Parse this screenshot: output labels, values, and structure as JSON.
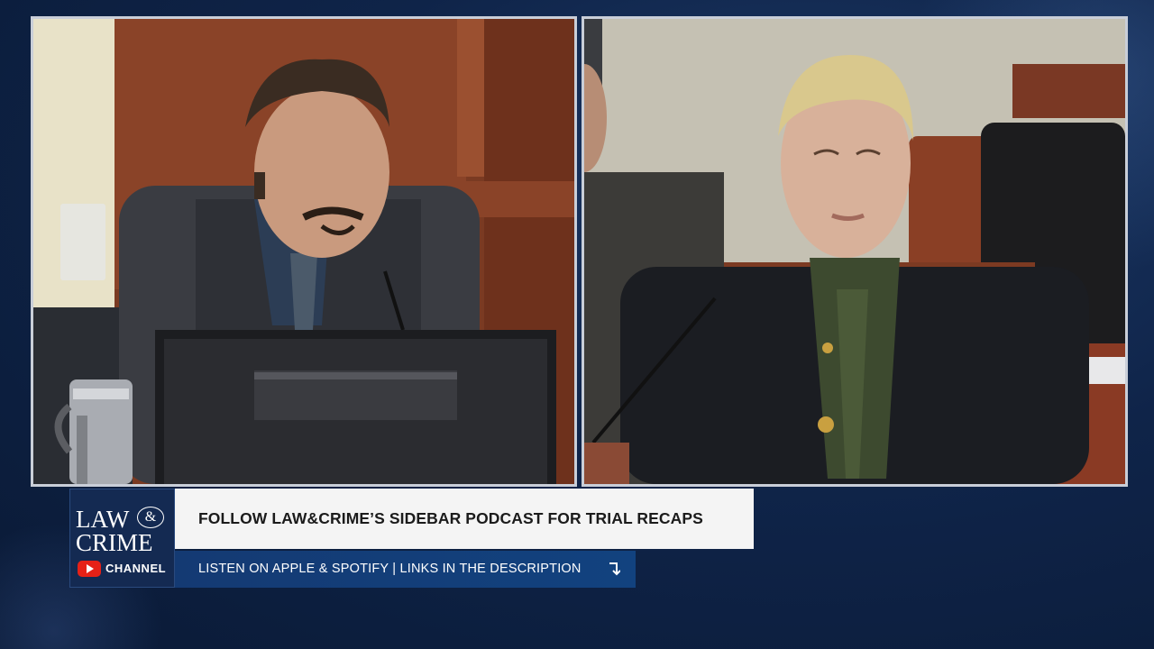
{
  "video": {
    "left_feed": {
      "scene": "witness-stand-camera"
    },
    "right_feed": {
      "scene": "defense-table-camera"
    }
  },
  "branding": {
    "logo_line1": "LAW",
    "logo_amp": "&",
    "logo_line2": "CRIME",
    "channel_label": "CHANNEL",
    "youtube_icon": "youtube-icon"
  },
  "lower_third": {
    "headline": "FOLLOW LAW&CRIME’S SIDEBAR PODCAST FOR TRIAL RECAPS",
    "subline": "LISTEN ON APPLE & SPOTIFY | LINKS IN THE DESCRIPTION",
    "arrow_icon": "arrow-down-icon"
  },
  "colors": {
    "background": "#0f2449",
    "headline_bg": "#f4f4f4",
    "subline_bg": "#143a73",
    "youtube_red": "#e62117"
  }
}
